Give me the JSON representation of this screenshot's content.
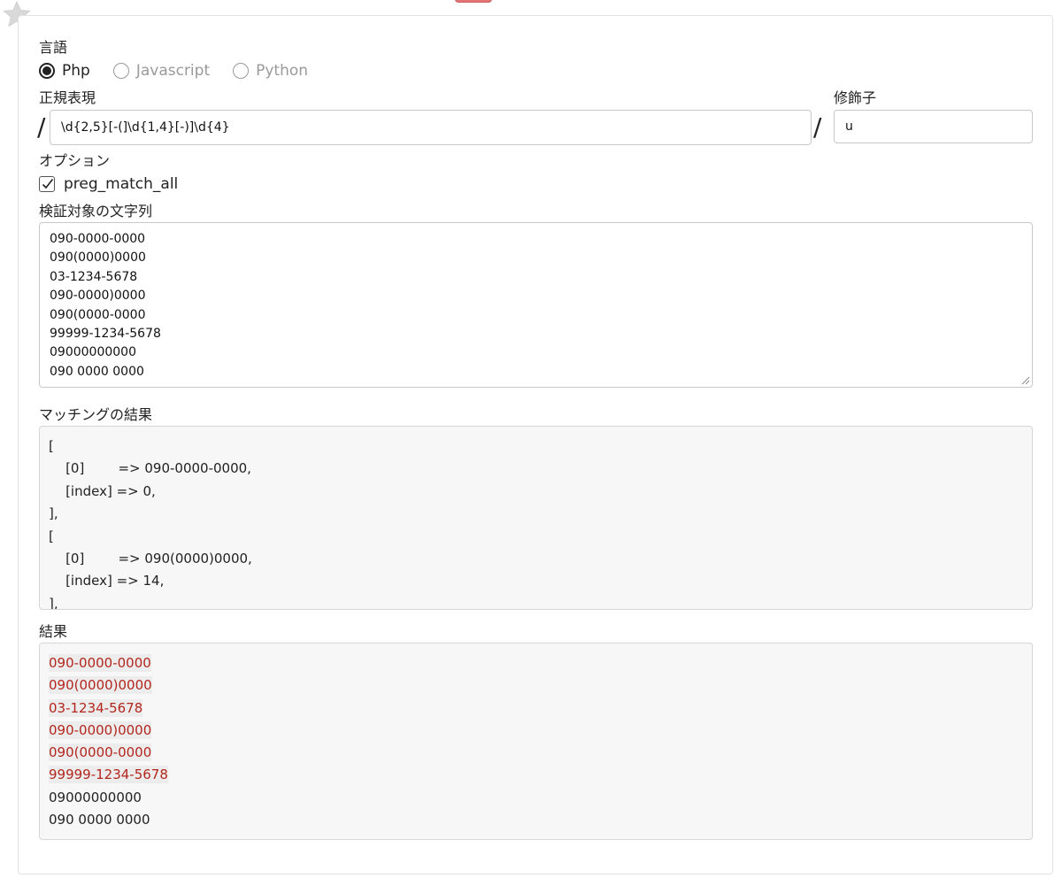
{
  "language": {
    "label": "言語",
    "options": [
      {
        "label": "Php",
        "checked": true
      },
      {
        "label": "Javascript",
        "checked": false
      },
      {
        "label": "Python",
        "checked": false
      }
    ]
  },
  "regex": {
    "label": "正規表現",
    "delimiter": "/",
    "value": "\\d{2,5}[-(]\\d{1,4}[-)]\\d{4}"
  },
  "modifier": {
    "label": "修飾子",
    "value": "u"
  },
  "options": {
    "label": "オプション",
    "preg_match_all": {
      "label": "preg_match_all",
      "checked": true
    }
  },
  "target": {
    "label": "検証対象の文字列",
    "lines": [
      "090-0000-0000",
      "090(0000)0000",
      "03-1234-5678",
      "090-0000)0000",
      "090(0000-0000",
      "99999-1234-5678",
      "09000000000",
      "090 0000 0000"
    ]
  },
  "match_result": {
    "label": "マッチングの結果",
    "lines": [
      "[",
      "    [0]        => 090-0000-0000,",
      "    [index] => 0,",
      "],",
      "[",
      "    [0]        => 090(0000)0000,",
      "    [index] => 14,",
      "],"
    ]
  },
  "result": {
    "label": "結果",
    "lines": [
      {
        "text": "090-0000-0000",
        "matched": true
      },
      {
        "text": "090(0000)0000",
        "matched": true
      },
      {
        "text": "03-1234-5678",
        "matched": true
      },
      {
        "text": "090-0000)0000",
        "matched": true
      },
      {
        "text": "090(0000-0000",
        "matched": true
      },
      {
        "text": "99999-1234-5678",
        "matched": true
      },
      {
        "text": "09000000000",
        "matched": false
      },
      {
        "text": "090 0000 0000",
        "matched": false
      }
    ]
  },
  "colors": {
    "match_text": "#b3261e",
    "match_bg": "#ececec",
    "box_bg": "#f7f7f7",
    "border": "#c8c8c8"
  }
}
